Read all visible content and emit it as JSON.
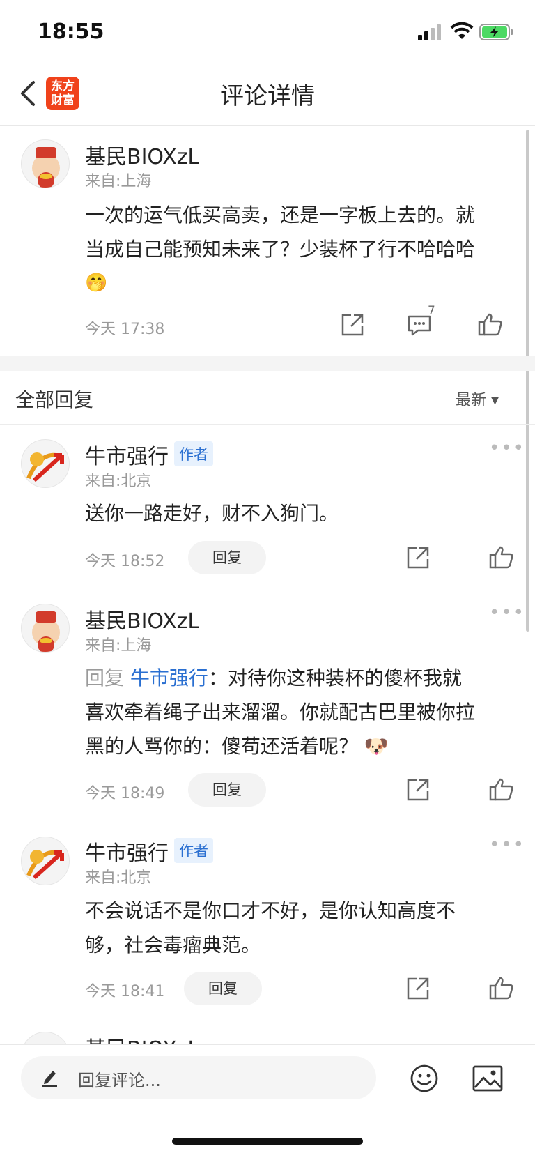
{
  "status": {
    "time": "18:55"
  },
  "nav": {
    "title": "评论详情",
    "logo_line1": "东方",
    "logo_line2": "财富"
  },
  "main_comment": {
    "user": "基民BIOXzL",
    "location": "来自:上海",
    "text_line1": "一次的运气低买高卖，还是一字板上去的。就",
    "text_line2": "当成自己能预知未来了？少装杯了行不哈哈哈",
    "emoji": "🤭",
    "time": "今天 17:38",
    "comment_count": "7"
  },
  "replies_header": {
    "title": "全部回复",
    "sort": "最新 ▾"
  },
  "replies": [
    {
      "user": "牛市强行",
      "badge": "作者",
      "location": "来自:北京",
      "text": "送你一路走好，财不入狗门。",
      "time": "今天 18:52",
      "reply_label": "回复"
    },
    {
      "user": "基民BIOXzL",
      "location": "来自:上海",
      "reply_prefix": "回复 ",
      "reply_to": "牛市强行",
      "text_line1": "：对待你这种装杯的傻杯我就",
      "text_line2": "喜欢牵着绳子出来溜溜。你就配古巴里被你拉",
      "text_line3": "黑的人骂你的：傻苟还活着呢？",
      "emoji": "🐶",
      "time": "今天 18:49",
      "reply_label": "回复"
    },
    {
      "user": "牛市强行",
      "badge": "作者",
      "location": "来自:北京",
      "text_line1": "不会说话不是你口才不好，是你认知高度不",
      "text_line2": "够，社会毒瘤典范。",
      "time": "今天 18:41",
      "reply_label": "回复"
    },
    {
      "user": "基民BIOXzL"
    }
  ],
  "bottom": {
    "input_placeholder": "回复评论..."
  },
  "colors": {
    "accent_blue": "#2a6fd1",
    "logo_red": "#f0421b"
  }
}
